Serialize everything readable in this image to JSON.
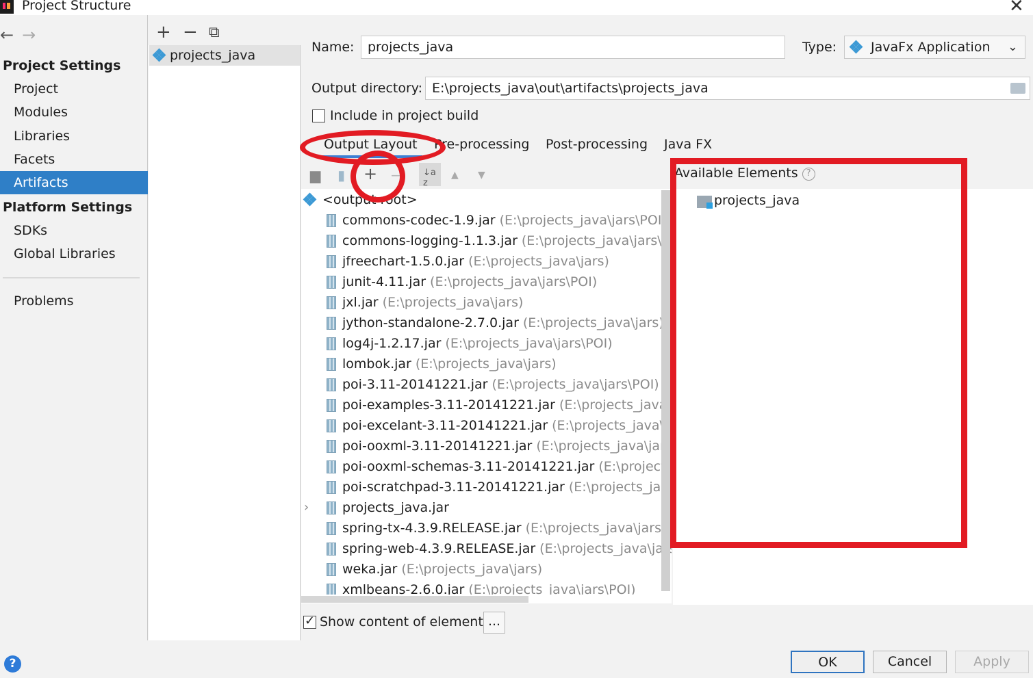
{
  "window": {
    "title": "Project Structure",
    "close_glyph": "✕"
  },
  "nav": {
    "back": "←",
    "forward": "→",
    "project_settings": "Project Settings",
    "project_items": [
      "Project",
      "Modules",
      "Libraries",
      "Facets",
      "Artifacts"
    ],
    "platform_settings": "Platform Settings",
    "platform_items": [
      "SDKs",
      "Global Libraries"
    ],
    "problems": "Problems",
    "active_item": "Artifacts"
  },
  "artifacts": {
    "toolbar": {
      "add": "+",
      "remove": "−",
      "copy": "⧉"
    },
    "items": [
      "projects_java"
    ]
  },
  "form": {
    "name_label": "Name:",
    "name_value": "projects_java",
    "type_label": "Type:",
    "type_value": "JavaFx Application",
    "output_dir_label": "Output directory:",
    "output_dir_value": "E:\\projects_java\\out\\artifacts\\projects_java",
    "include_label": "Include in project build",
    "include_checked": false
  },
  "tabs": [
    "Output Layout",
    "Pre-processing",
    "Post-processing",
    "Java FX"
  ],
  "active_tab": "Output Layout",
  "layout_toolbar": {
    "add": "+",
    "remove": "−",
    "sort": "↓a z",
    "up": "▲",
    "down": "▼"
  },
  "tree": {
    "root": "<output root>",
    "items": [
      {
        "name": "commons-codec-1.9.jar",
        "path": "(E:\\projects_java\\jars\\POI)"
      },
      {
        "name": "commons-logging-1.1.3.jar",
        "path": "(E:\\projects_java\\jars\\POI)"
      },
      {
        "name": "jfreechart-1.5.0.jar",
        "path": "(E:\\projects_java\\jars)"
      },
      {
        "name": "junit-4.11.jar",
        "path": "(E:\\projects_java\\jars\\POI)"
      },
      {
        "name": "jxl.jar",
        "path": "(E:\\projects_java\\jars)"
      },
      {
        "name": "jython-standalone-2.7.0.jar",
        "path": "(E:\\projects_java\\jars)"
      },
      {
        "name": "log4j-1.2.17.jar",
        "path": "(E:\\projects_java\\jars\\POI)"
      },
      {
        "name": "lombok.jar",
        "path": "(E:\\projects_java\\jars)"
      },
      {
        "name": "poi-3.11-20141221.jar",
        "path": "(E:\\projects_java\\jars\\POI)"
      },
      {
        "name": "poi-examples-3.11-20141221.jar",
        "path": "(E:\\projects_java\\jars\\POI)"
      },
      {
        "name": "poi-excelant-3.11-20141221.jar",
        "path": "(E:\\projects_java\\jars\\POI)"
      },
      {
        "name": "poi-ooxml-3.11-20141221.jar",
        "path": "(E:\\projects_java\\jars\\POI)"
      },
      {
        "name": "poi-ooxml-schemas-3.11-20141221.jar",
        "path": "(E:\\projects_java\\jars\\POI)"
      },
      {
        "name": "poi-scratchpad-3.11-20141221.jar",
        "path": "(E:\\projects_java\\jars\\POI)"
      },
      {
        "name": "projects_java.jar",
        "path": ""
      },
      {
        "name": "spring-tx-4.3.9.RELEASE.jar",
        "path": "(E:\\projects_java\\jars\\spring)"
      },
      {
        "name": "spring-web-4.3.9.RELEASE.jar",
        "path": "(E:\\projects_java\\jars\\spring)"
      },
      {
        "name": "weka.jar",
        "path": "(E:\\projects_java\\jars)"
      },
      {
        "name": "xmlbeans-2.6.0.jar",
        "path": "(E:\\projects_java\\jars\\POI)"
      }
    ],
    "expandable_item": "projects_java.jar"
  },
  "available": {
    "header": "Available Elements",
    "help": "?",
    "items": [
      "projects_java"
    ]
  },
  "show_content": {
    "label": "Show content of elements",
    "checked": true,
    "dots": "..."
  },
  "buttons": {
    "help": "?",
    "ok": "OK",
    "cancel": "Cancel",
    "apply": "Apply"
  },
  "colors": {
    "selection": "#2f7fc7",
    "annotation": "#e21b23",
    "tab_underline": "#3d7fd4"
  }
}
